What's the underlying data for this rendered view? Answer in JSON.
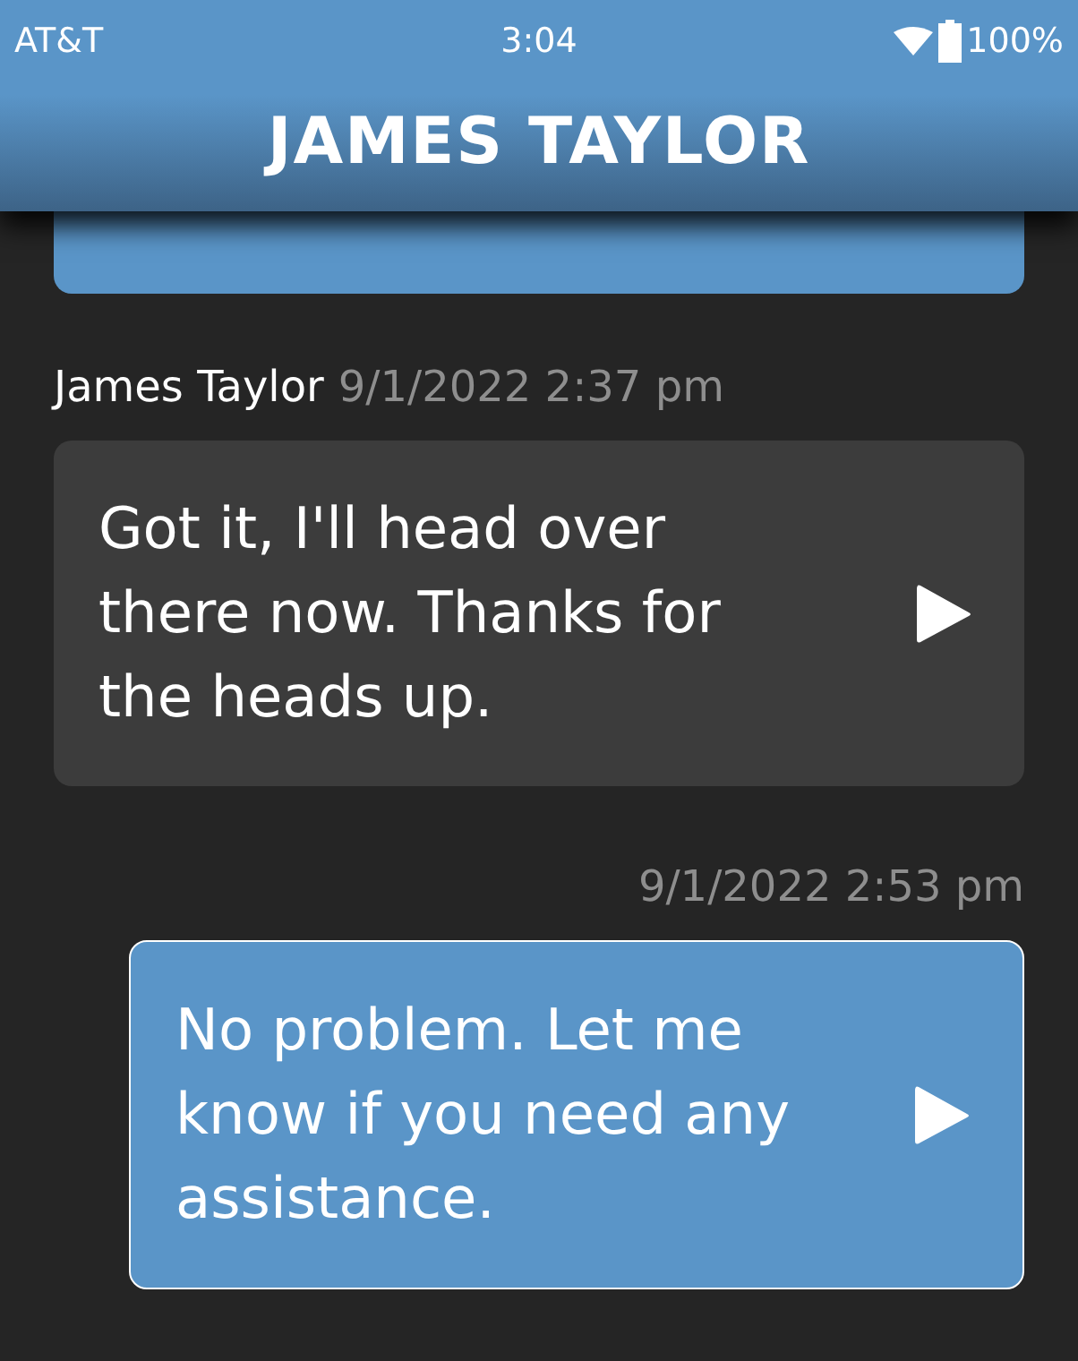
{
  "status_bar": {
    "carrier": "AT&T",
    "time": "3:04",
    "battery": "100%"
  },
  "header": {
    "title": "JAMES TAYLOR"
  },
  "partial_message": {
    "kind": "outgoing"
  },
  "messages": [
    {
      "kind": "incoming",
      "sender": "James Taylor",
      "timestamp": "9/1/2022 2:37 pm",
      "text": "Got it, I'll head over there now. Thanks for the heads up."
    },
    {
      "kind": "outgoing",
      "timestamp": "9/1/2022 2:53 pm",
      "text": "No problem. Let me know if you need any assistance."
    }
  ]
}
